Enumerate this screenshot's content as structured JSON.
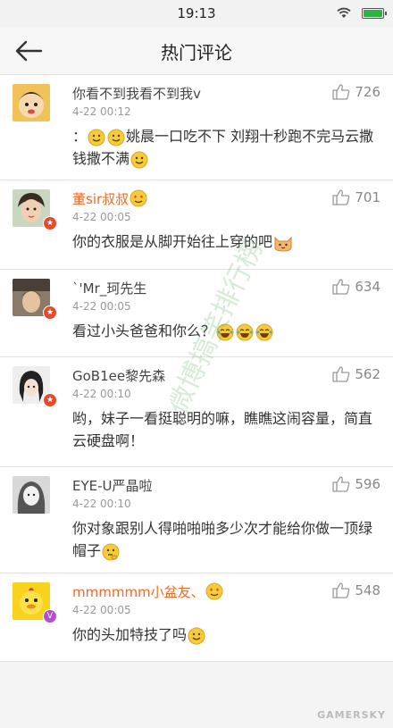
{
  "status_bar": {
    "time": "19:13"
  },
  "header": {
    "title": "热门评论"
  },
  "comments": [
    {
      "user": "你看不到我看不到我v",
      "time": "4-22 00:12",
      "likes": "726",
      "text_parts": [
        "：",
        "姚晨一口吃不下 刘翔十秒跑不完马云撒钱撒不满"
      ]
    },
    {
      "user": "董sir叔叔",
      "time": "4-22 00:05",
      "likes": "701",
      "text_parts": [
        "你的衣服是从脚开始往上穿的吧"
      ]
    },
    {
      "user": "`'Mr_珂先生",
      "time": "4-22 00:05",
      "likes": "634",
      "text_parts": [
        "看过小头爸爸和你么？"
      ]
    },
    {
      "user": "GoB1ee黎先森",
      "time": "4-22 00:10",
      "likes": "562",
      "text_parts": [
        "哟，妹子一看挺聪明的嘛，瞧瞧这闹容量，简直云硬盘啊！"
      ]
    },
    {
      "user": "EYE-U严晶啦",
      "time": "4-22 00:10",
      "likes": "596",
      "text_parts": [
        "你对象跟别人得啪啪啪多少次才能给你做一顶绿帽子"
      ]
    },
    {
      "user": "mmmmmm小盆友、",
      "time": "4-22 00:05",
      "likes": "548",
      "text_parts": [
        "你的头加特技了吗"
      ]
    }
  ],
  "watermark": {
    "text": "微博搞笑排行榜"
  },
  "corner_logo": {
    "text": "GAMERSKY"
  },
  "colors": {
    "accent_name": "#f06a22",
    "badge_red": "#e74a2a",
    "badge_purple": "#b24fd0",
    "battery": "#2fb344"
  }
}
